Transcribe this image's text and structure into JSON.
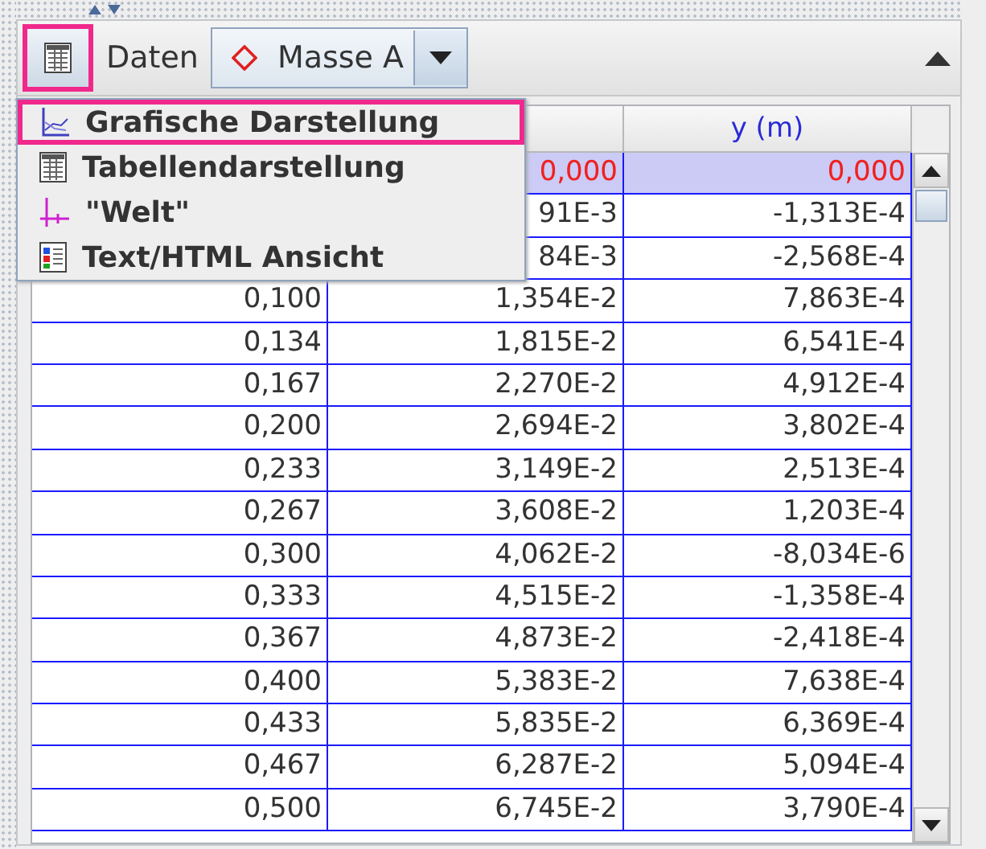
{
  "toolbar": {
    "view_button": {
      "highlighted": true
    },
    "label": "Daten",
    "object_select": {
      "value": "Masse A"
    }
  },
  "menu": {
    "items": [
      {
        "kind": "graph",
        "label": "Grafische Darstellung",
        "highlighted": true
      },
      {
        "kind": "table",
        "label": "Tabellendarstellung",
        "highlighted": false
      },
      {
        "kind": "world",
        "label": "\"Welt\"",
        "highlighted": false
      },
      {
        "kind": "text",
        "label": "Text/HTML Ansicht",
        "highlighted": false
      }
    ]
  },
  "table": {
    "y_column_header": "y (m)",
    "rows": [
      {
        "selected": true,
        "cells": [
          null,
          "0,000",
          "0,000"
        ]
      },
      {
        "selected": false,
        "cells": [
          null,
          "91E-3",
          "-1,313E-4"
        ]
      },
      {
        "selected": false,
        "cells": [
          null,
          "84E-3",
          "-2,568E-4"
        ]
      },
      {
        "selected": false,
        "cells": [
          "0,100",
          "1,354E-2",
          "7,863E-4"
        ]
      },
      {
        "selected": false,
        "cells": [
          "0,134",
          "1,815E-2",
          "6,541E-4"
        ]
      },
      {
        "selected": false,
        "cells": [
          "0,167",
          "2,270E-2",
          "4,912E-4"
        ]
      },
      {
        "selected": false,
        "cells": [
          "0,200",
          "2,694E-2",
          "3,802E-4"
        ]
      },
      {
        "selected": false,
        "cells": [
          "0,233",
          "3,149E-2",
          "2,513E-4"
        ]
      },
      {
        "selected": false,
        "cells": [
          "0,267",
          "3,608E-2",
          "1,203E-4"
        ]
      },
      {
        "selected": false,
        "cells": [
          "0,300",
          "4,062E-2",
          "-8,034E-6"
        ]
      },
      {
        "selected": false,
        "cells": [
          "0,333",
          "4,515E-2",
          "-1,358E-4"
        ]
      },
      {
        "selected": false,
        "cells": [
          "0,367",
          "4,873E-2",
          "-2,418E-4"
        ]
      },
      {
        "selected": false,
        "cells": [
          "0,400",
          "5,383E-2",
          "7,638E-4"
        ]
      },
      {
        "selected": false,
        "cells": [
          "0,433",
          "5,835E-2",
          "6,369E-4"
        ]
      },
      {
        "selected": false,
        "cells": [
          "0,467",
          "6,287E-2",
          "5,094E-4"
        ]
      },
      {
        "selected": false,
        "cells": [
          "0,500",
          "6,745E-2",
          "3,790E-4"
        ]
      }
    ]
  }
}
